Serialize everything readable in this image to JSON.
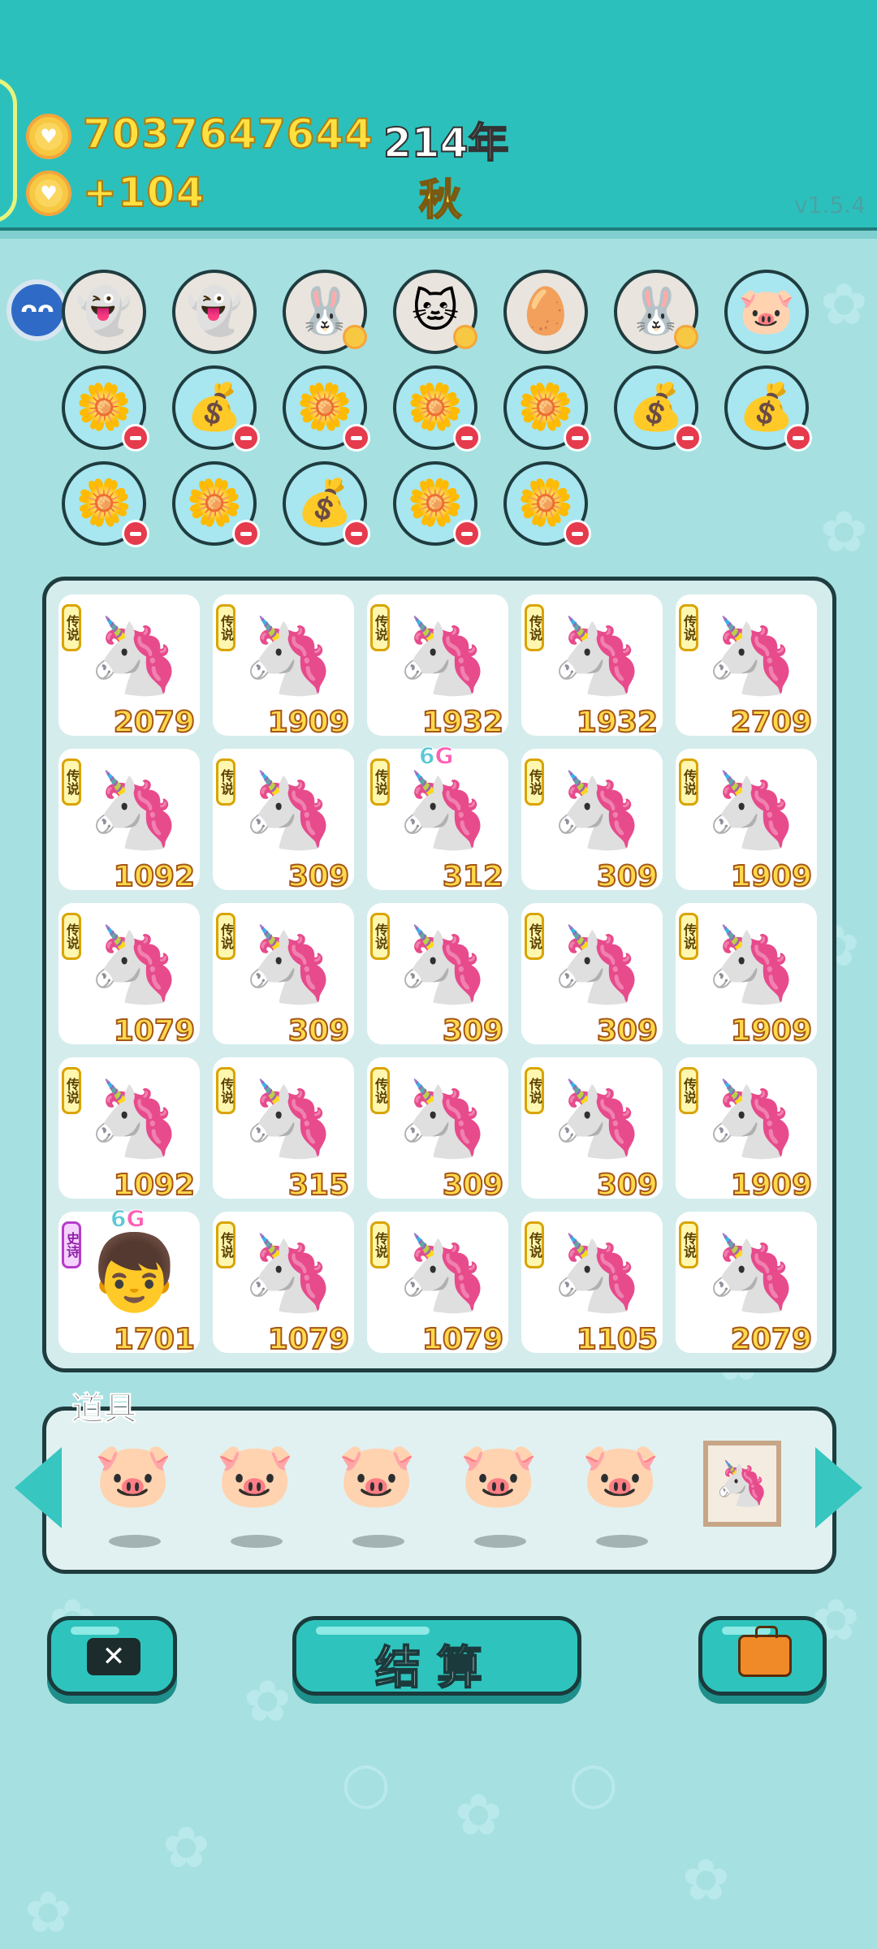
{
  "header": {
    "money": "7037647644",
    "income": "+104",
    "year": "214年",
    "season": "秋",
    "version": "v1.5.4"
  },
  "shelf": {
    "row1": [
      {
        "icon": "ghost-icon",
        "glyph": "👻"
      },
      {
        "icon": "ghost-icon",
        "glyph": "👻"
      },
      {
        "icon": "rabbit-icon",
        "glyph": "🐰"
      },
      {
        "icon": "cat-icon",
        "glyph": "🐱"
      },
      {
        "icon": "egg-tray-icon",
        "glyph": "🥚"
      },
      {
        "icon": "rabbit-icon",
        "glyph": "🐰"
      },
      {
        "icon": "piggy-bank-icon",
        "glyph": "🐷"
      }
    ],
    "row2": [
      {
        "icon": "flower-pot-icon",
        "glyph": "🌼"
      },
      {
        "icon": "sack-icon",
        "glyph": "💰"
      },
      {
        "icon": "flower-pot-icon",
        "glyph": "🌼"
      },
      {
        "icon": "flower-pot-icon",
        "glyph": "🌼"
      },
      {
        "icon": "flower-pot-icon",
        "glyph": "🌼"
      },
      {
        "icon": "sack-icon",
        "glyph": "💰"
      },
      {
        "icon": "sack-icon",
        "glyph": "💰"
      }
    ],
    "row3": [
      {
        "icon": "flower-pot-icon",
        "glyph": "🌼"
      },
      {
        "icon": "flower-pot-icon",
        "glyph": "🌼"
      },
      {
        "icon": "sack-icon",
        "glyph": "💰"
      },
      {
        "icon": "flower-pot-icon",
        "glyph": "🌼"
      },
      {
        "icon": "flower-pot-icon",
        "glyph": "🌼"
      }
    ]
  },
  "board": {
    "legend_tag": "传说",
    "epic_tag": "史诗",
    "cards": [
      {
        "value": "2079"
      },
      {
        "value": "1909"
      },
      {
        "value": "1932"
      },
      {
        "value": "1932"
      },
      {
        "value": "2709"
      },
      {
        "value": "1092"
      },
      {
        "value": "309"
      },
      {
        "value": "312",
        "badge": "6G"
      },
      {
        "value": "309"
      },
      {
        "value": "1909"
      },
      {
        "value": "1079"
      },
      {
        "value": "309"
      },
      {
        "value": "309"
      },
      {
        "value": "309"
      },
      {
        "value": "1909"
      },
      {
        "value": "1092"
      },
      {
        "value": "315"
      },
      {
        "value": "309"
      },
      {
        "value": "309"
      },
      {
        "value": "1909"
      },
      {
        "value": "1701",
        "badge": "6G",
        "epic": true
      },
      {
        "value": "1079"
      },
      {
        "value": "1079"
      },
      {
        "value": "1105"
      },
      {
        "value": "2079"
      }
    ]
  },
  "tools": {
    "title": "道具",
    "items": [
      "piggy-bank-icon",
      "piggy-bank-icon",
      "piggy-bank-icon",
      "piggy-bank-icon",
      "piggy-bank-icon",
      "unicorn-picture-icon"
    ]
  },
  "buttons": {
    "close": "✕",
    "settle": "结算",
    "bag": "bag-icon"
  },
  "colors": {
    "header": "#2cc0bd",
    "background": "#a6e0e1",
    "value_text": "#ffd94a",
    "button": "#2ec4bd"
  }
}
